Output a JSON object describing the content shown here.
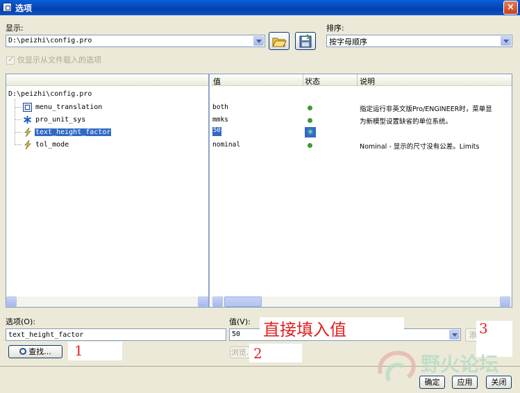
{
  "window": {
    "title": "选项",
    "close": "×"
  },
  "display": {
    "label": "显示:",
    "file": "D:\\peizhi\\config.pro"
  },
  "sort": {
    "label": "排序:",
    "value": "按字母顺序"
  },
  "checkbox": {
    "label": "仅显示从文件载入的选项",
    "checked": true
  },
  "tree": {
    "root": "D:\\peizhi\\config.pro",
    "items": [
      {
        "name": "menu_translation",
        "icon": "option-box-icon",
        "value": "both",
        "description": "指定运行非英文版Pro/ENGINEER时，菜单显"
      },
      {
        "name": "pro_unit_sys",
        "icon": "asterisk-icon",
        "value": "mmks",
        "description": "为新模型设置缺省的单位系统。"
      },
      {
        "name": "text_height_factor",
        "icon": "lightning-icon",
        "value": "50",
        "description": "",
        "selected": true
      },
      {
        "name": "tol_mode",
        "icon": "lightning-icon",
        "value": "nominal",
        "description": "Nominal - 显示的尺寸没有公差。Limits"
      }
    ]
  },
  "columns": {
    "value": "值",
    "status": "状态",
    "desc": "说明"
  },
  "option_field": {
    "label": "选项(O):",
    "value": "text_height_factor"
  },
  "value_field": {
    "label": "值(V):",
    "value": "50"
  },
  "buttons": {
    "find": "查找...",
    "browse": "浏览...",
    "add": "添",
    "ok": "确定",
    "apply": "应用",
    "close": "关闭"
  },
  "annotations": {
    "direct_input": "直接填入值",
    "n1": "1",
    "n2": "2",
    "n3": "3"
  },
  "watermark": "野火论坛"
}
